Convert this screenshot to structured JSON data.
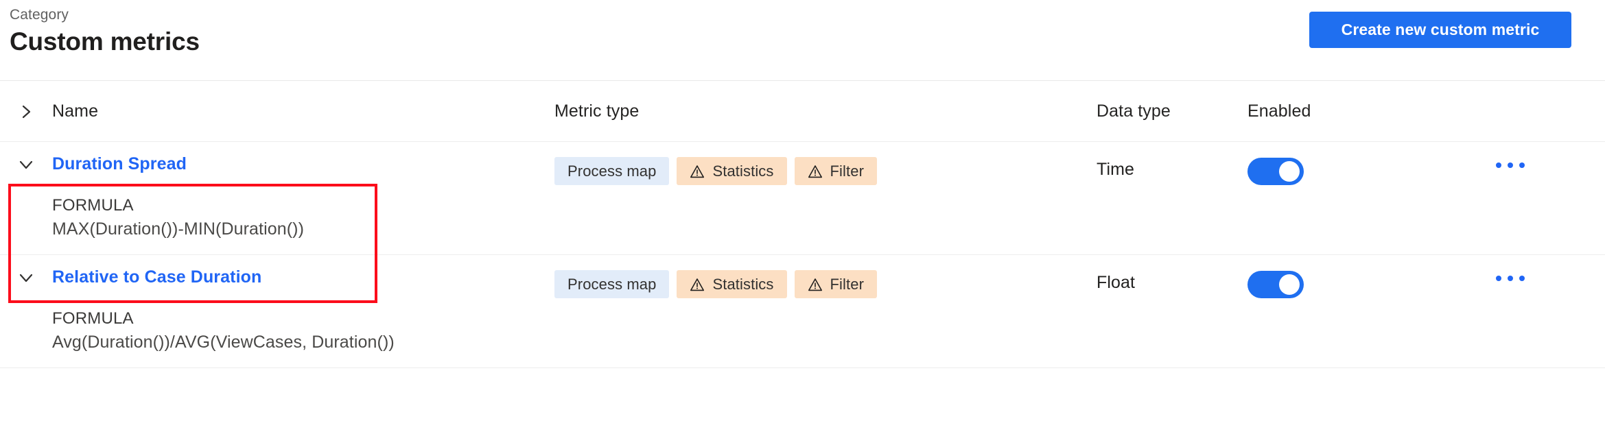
{
  "header": {
    "category_label": "Category",
    "title": "Custom metrics",
    "create_button_label": "Create new custom metric",
    "accent_color": "#1f6ff0"
  },
  "table": {
    "columns": {
      "expand_icon": "chevron-right-icon",
      "name": "Name",
      "metric_type": "Metric type",
      "data_type": "Data type",
      "enabled": "Enabled"
    },
    "formula_label": "FORMULA",
    "rows": [
      {
        "name": "Duration Spread",
        "expanded": true,
        "formula": "MAX(Duration())-MIN(Duration())",
        "badges": [
          {
            "label": "Process map",
            "style": "blue",
            "icon": null
          },
          {
            "label": "Statistics",
            "style": "orange",
            "icon": "warning-triangle-icon"
          },
          {
            "label": "Filter",
            "style": "orange",
            "icon": "warning-triangle-icon"
          }
        ],
        "data_type": "Time",
        "enabled": true,
        "highlighted": true
      },
      {
        "name": "Relative to Case Duration",
        "expanded": true,
        "formula": "Avg(Duration())/AVG(ViewCases, Duration())",
        "badges": [
          {
            "label": "Process map",
            "style": "blue",
            "icon": null
          },
          {
            "label": "Statistics",
            "style": "orange",
            "icon": "warning-triangle-icon"
          },
          {
            "label": "Filter",
            "style": "orange",
            "icon": "warning-triangle-icon"
          }
        ],
        "data_type": "Float",
        "enabled": true,
        "highlighted": false
      }
    ],
    "row_actions_icon": "ellipsis-horizontal-icon"
  },
  "annotation": {
    "highlight_color": "#fc0d1b"
  }
}
